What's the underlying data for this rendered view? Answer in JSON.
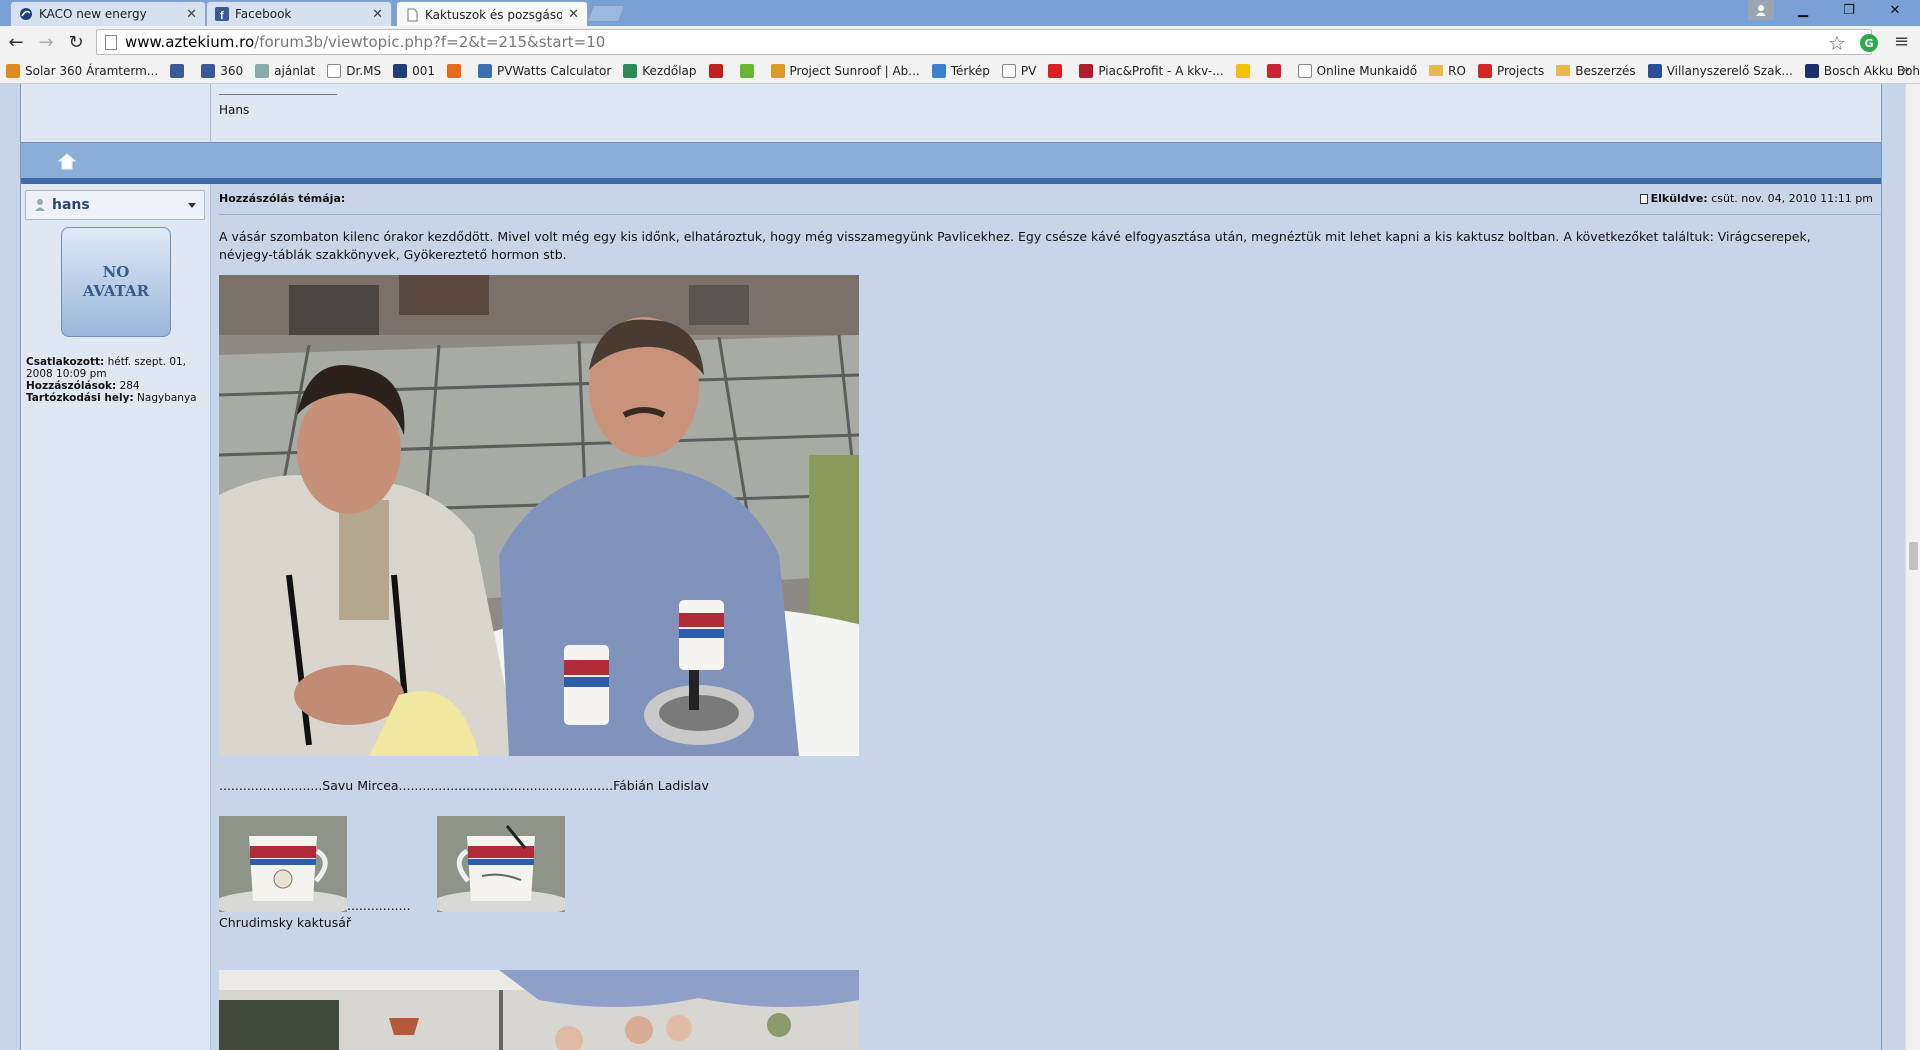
{
  "browser": {
    "tabs": [
      {
        "label": "KACO new energy"
      },
      {
        "label": "Facebook"
      },
      {
        "label": "Kaktuszok és pozsgások -"
      }
    ],
    "url_host": "www.aztekium.ro",
    "url_path": "/forum3b/viewtopic.php?f=2&t=215&start=10"
  },
  "bookmarks": [
    {
      "label": "Solar 360 Áramterm...",
      "icon": "solar-icon",
      "color": "#e08a1e"
    },
    {
      "label": "",
      "icon": "facebook-icon",
      "color": "#3b5998"
    },
    {
      "label": "360",
      "icon": "facebook-icon",
      "color": "#3b5998"
    },
    {
      "label": "ajánlat",
      "icon": "gear-icon",
      "color": "#8aa"
    },
    {
      "label": "Dr.MS",
      "icon": "page-icon",
      "color": "#ffffff"
    },
    {
      "label": "001",
      "icon": "kaco-icon",
      "color": "#1f3f7a"
    },
    {
      "label": "",
      "icon": "avast-icon",
      "color": "#e8691b"
    },
    {
      "label": "PVWatts Calculator",
      "icon": "grid-icon",
      "color": "#3a6fb0"
    },
    {
      "label": "Kezdőlap",
      "icon": "refresh-icon",
      "color": "#2e8b57"
    },
    {
      "label": "",
      "icon": "red-logo-icon",
      "color": "#c21f1f"
    },
    {
      "label": "",
      "icon": "green-logo-icon",
      "color": "#6ab632"
    },
    {
      "label": "Project Sunroof | Ab...",
      "icon": "search-icon",
      "color": "#d99a2b"
    },
    {
      "label": "Térkép",
      "icon": "map-icon",
      "color": "#3a7fd0"
    },
    {
      "label": "PV",
      "icon": "page-icon",
      "color": "#ffffff"
    },
    {
      "label": "",
      "icon": "p-icon",
      "color": "#d62121"
    },
    {
      "label": "Piac&Profit - A kkv-...",
      "icon": "pp-icon",
      "color": "#b01e2e"
    },
    {
      "label": "",
      "icon": "pacman-icon",
      "color": "#f2c200"
    },
    {
      "label": "",
      "icon": "opera-icon",
      "color": "#c23"
    },
    {
      "label": "Online Munkaidő",
      "icon": "page-icon",
      "color": "#ffffff"
    },
    {
      "label": "RO",
      "icon": "folder-icon",
      "color": "#e8b84a"
    },
    {
      "label": "Projects",
      "icon": "eye-icon",
      "color": "#d02727"
    },
    {
      "label": "Beszerzés",
      "icon": "folder-icon",
      "color": "#e8b84a"
    },
    {
      "label": "Villanyszerelő Szak...",
      "icon": "vf-icon",
      "color": "#2b4e9c"
    },
    {
      "label": "Bosch Akku Bohrha...",
      "icon": "bosch-icon",
      "color": "#1e2f6f"
    }
  ],
  "prev_post": {
    "signature": "Hans"
  },
  "post": {
    "username": "hans",
    "avatar_text": "NO AVATAR",
    "profile": {
      "joined_label": "Csatlakozott:",
      "joined_value": "hétf. szept. 01, 2008 10:09 pm",
      "posts_label": "Hozzászólások:",
      "posts_value": "284",
      "location_label": "Tartózkodási hely:",
      "location_value": "Nagybanya"
    },
    "subject_label": "Hozzászólás témája:",
    "sent_label": "Elküldve:",
    "sent_value": "csüt. nov. 04, 2010 11:11 pm",
    "body": "A vásár szombaton kilenc órakor kezdődött. Mivel volt még egy kis időnk, elhatároztuk, hogy még visszamegyünk Pavlicekhez. Egy csésze kávé elfogyasztása után, megnéztük mit lehet kapni a kis kaktusz boltban. A következőket találtuk: Virágcserepek, névjegy-táblák szakkönyvek, Gyökereztető hormon stb.",
    "caption": "..........................Savu Mircea......................................................Fábián Ladislav",
    "thumb_dots": "................",
    "caption2": "Chrudimsky kaktusář"
  }
}
